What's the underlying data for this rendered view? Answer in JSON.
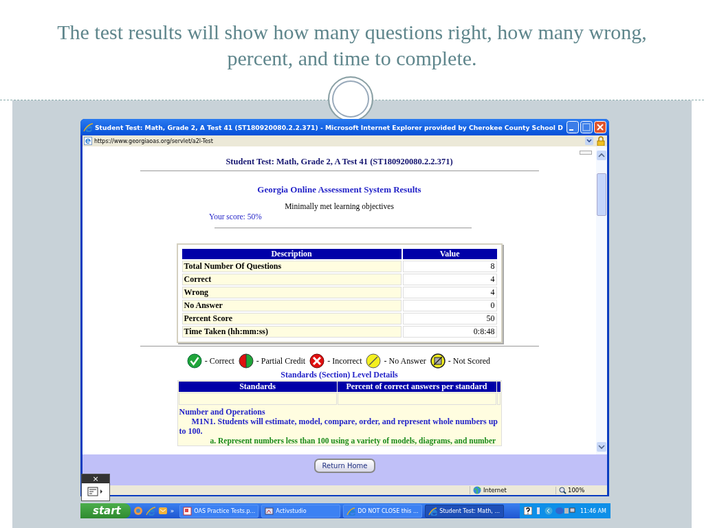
{
  "slide": {
    "title": "The test results will show how many questions right, how many wrong, percent, and time to complete."
  },
  "browser": {
    "title": "Student Test: Math, Grade 2, A Test 41 (ST180920080.2.2.371) - Microsoft Internet Explorer provided by Cherokee County School D",
    "address": "https://www.georgiaoas.org/servlet/a2l-Test"
  },
  "page": {
    "heading": "Student Test: Math, Grade 2, A Test 41 (ST180920080.2.2.371)",
    "system_title": "Georgia Online Assessment System Results",
    "performance": "Minimally met learning objectives",
    "score": "Your score: 50%",
    "results_table": {
      "columns": [
        "Description",
        "Value"
      ],
      "rows": [
        {
          "description": "Total Number Of Questions",
          "value": "8"
        },
        {
          "description": "Correct",
          "value": "4"
        },
        {
          "description": "Wrong",
          "value": "4"
        },
        {
          "description": "No Answer",
          "value": "0"
        },
        {
          "description": "Percent Score",
          "value": "50"
        },
        {
          "description": "Time Taken (hh:mm:ss)",
          "value": "0:8:48"
        }
      ]
    },
    "legend": [
      {
        "kind": "correct",
        "label": "- Correct"
      },
      {
        "kind": "partial",
        "label": "- Partial Credit"
      },
      {
        "kind": "incorrect",
        "label": "- Incorrect"
      },
      {
        "kind": "no_answer",
        "label": "- No Answer"
      },
      {
        "kind": "not_scored",
        "label": "- Not Scored"
      }
    ],
    "standards_title": "Standards (Section) Level Details",
    "standards_table": {
      "columns": [
        "Standards",
        "Percent of correct answers per standard"
      ],
      "domain": "Number and Operations",
      "standard": "M1N1. Students will estimate, model, compare, order, and represent whole numbers up to 100.",
      "element": "a. Represent numbers less than 100 using a variety of models, diagrams, and number"
    }
  },
  "return_button": "Return Home",
  "status_bar": {
    "zone": "Internet",
    "zoom": "100%"
  },
  "widget": {
    "close": "×"
  },
  "taskbar": {
    "start": "start",
    "more": "»",
    "buttons": [
      {
        "kind": "ppt",
        "label": "OAS Practice Tests.p...",
        "selected": false
      },
      {
        "kind": "app",
        "label": "Activstudio",
        "selected": false
      },
      {
        "kind": "ie",
        "label": "DO NOT CLOSE this ...",
        "selected": false
      },
      {
        "kind": "ie",
        "label": "Student Test: Math, ...",
        "selected": true
      }
    ],
    "clock": "11:46 AM"
  }
}
